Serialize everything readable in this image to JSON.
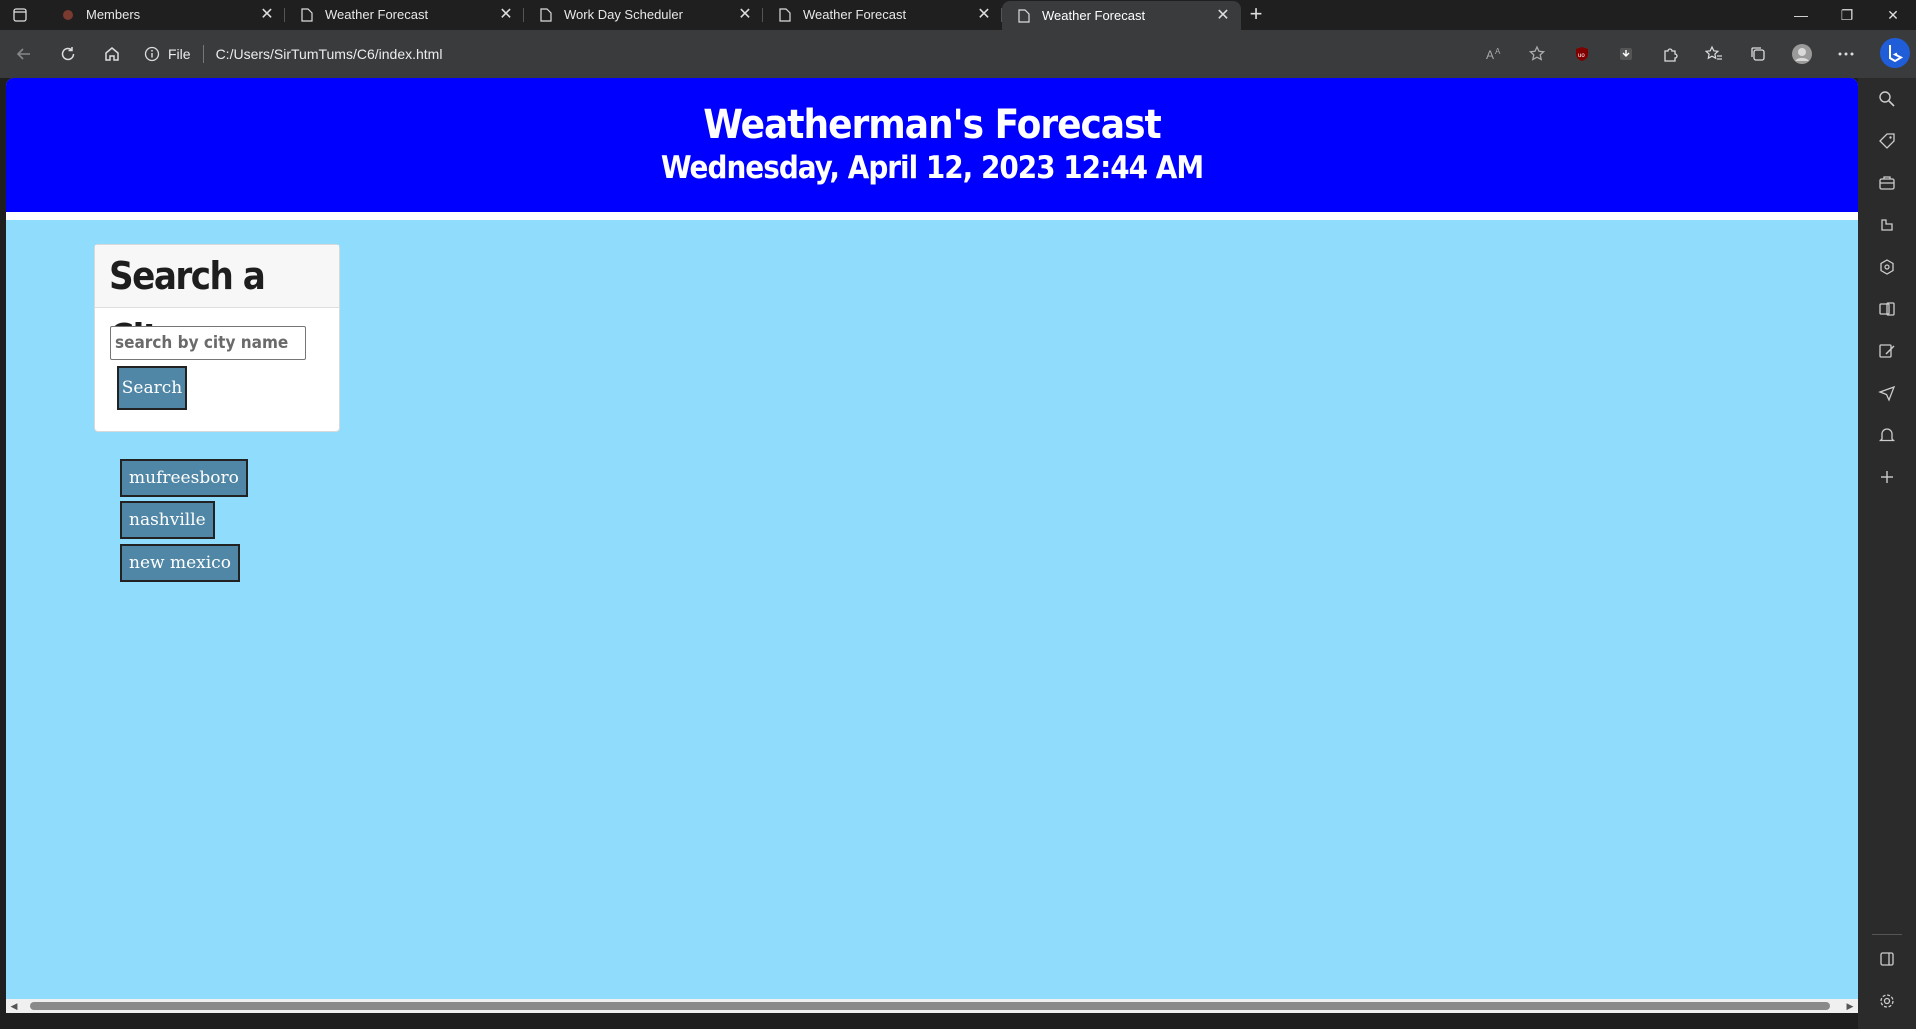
{
  "tabs": [
    {
      "title": "Members",
      "icon": "members-favicon"
    },
    {
      "title": "Weather Forecast",
      "icon": "page-icon"
    },
    {
      "title": "Work Day Scheduler",
      "icon": "page-icon"
    },
    {
      "title": "Weather Forecast",
      "icon": "page-icon"
    },
    {
      "title": "Weather Forecast",
      "icon": "page-icon",
      "active": true
    }
  ],
  "address": {
    "scheme_label": "File",
    "url": "C:/Users/SirTumTums/C6/index.html"
  },
  "page": {
    "title": "Weatherman's Forecast",
    "date": "Wednesday, April 12, 2023 12:44 AM",
    "search_card": {
      "heading": "Search a City",
      "placeholder": "search by city name",
      "button_label": "Search"
    },
    "history": [
      "mufreesboro",
      "nashville",
      "new mexico"
    ]
  },
  "colors": {
    "header_bg": "#0000ff",
    "page_bg": "#8fdcfc",
    "button_bg": "#5187a6"
  }
}
